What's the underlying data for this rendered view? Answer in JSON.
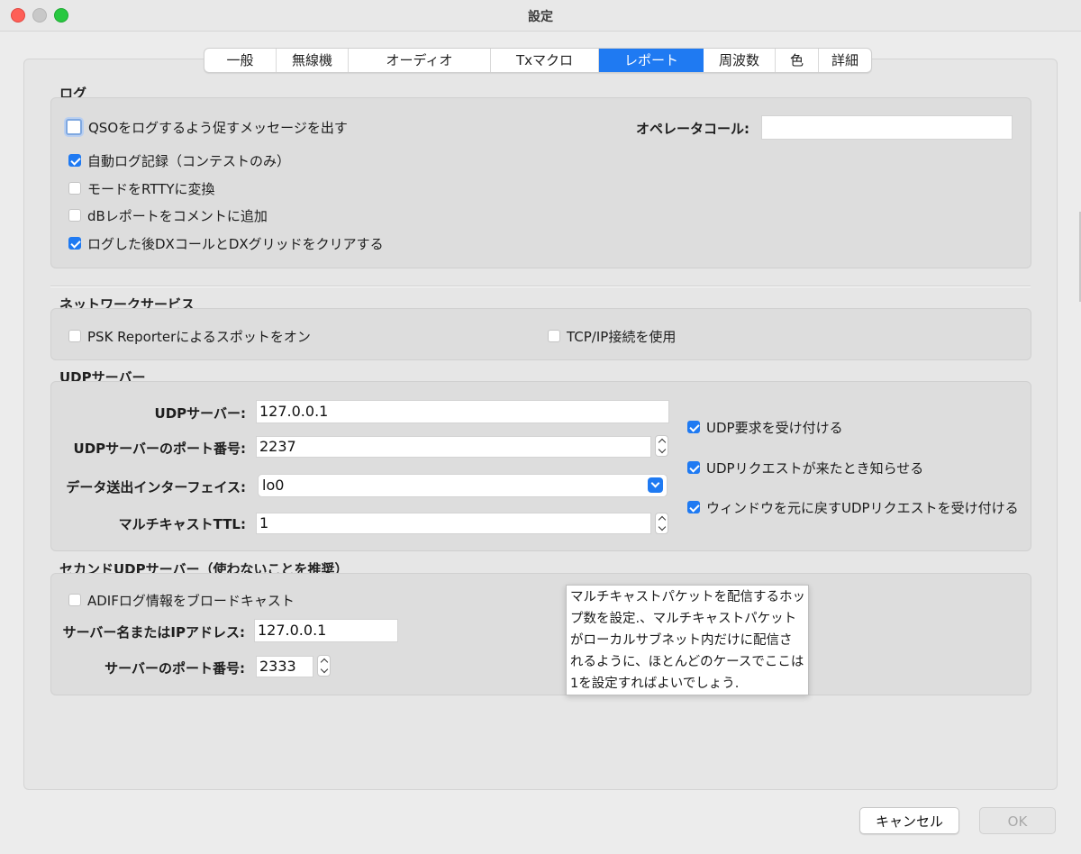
{
  "window": {
    "title": "設定"
  },
  "tabs": [
    {
      "label": "一般",
      "active": false
    },
    {
      "label": "無線機",
      "active": false
    },
    {
      "label": "オーディオ",
      "active": false
    },
    {
      "label": "Txマクロ",
      "active": false
    },
    {
      "label": "レポート",
      "active": true
    },
    {
      "label": "周波数",
      "active": false
    },
    {
      "label": "色",
      "active": false
    },
    {
      "label": "詳細",
      "active": false
    }
  ],
  "log": {
    "title": "ログ",
    "prompt_qso": {
      "label": "QSOをログするよう促すメッセージを出す",
      "checked": false
    },
    "auto_log": {
      "label": "自動ログ記録（コンテストのみ）",
      "checked": true
    },
    "convert_rtty": {
      "label": "モードをRTTYに変換",
      "checked": false
    },
    "db_report": {
      "label": "dBレポートをコメントに追加",
      "checked": false
    },
    "clear_dx": {
      "label": "ログした後DXコールとDXグリッドをクリアする",
      "checked": true
    },
    "operator_label": "オペレータコール:",
    "operator_value": ""
  },
  "network": {
    "title": "ネットワークサービス",
    "psk": {
      "label": "PSK Reporterによるスポットをオン",
      "checked": false
    },
    "tcp": {
      "label": "TCP/IP接続を使用",
      "checked": false
    }
  },
  "udp": {
    "title": "UDPサーバー",
    "server_label": "UDPサーバー:",
    "server_value": "127.0.0.1",
    "port_label": "UDPサーバーのポート番号:",
    "port_value": "2237",
    "iface_label": "データ送出インターフェイス:",
    "iface_value": "lo0",
    "ttl_label": "マルチキャストTTL:",
    "ttl_value": "1",
    "accept": {
      "label": "UDP要求を受け付ける",
      "checked": true
    },
    "notify": {
      "label": "UDPリクエストが来たとき知らせる",
      "checked": true
    },
    "restore": {
      "label": "ウィンドウを元に戻すUDPリクエストを受け付ける",
      "checked": true
    }
  },
  "second_udp": {
    "title": "セカンドUDPサーバー（使わないことを推奨）",
    "adif": {
      "label": "ADIFログ情報をブロードキャスト",
      "checked": false
    },
    "server_label": "サーバー名またはIPアドレス:",
    "server_value": "127.0.0.1",
    "port_label": "サーバーのポート番号:",
    "port_value": "2333"
  },
  "tooltip": {
    "lines": [
      "マルチキャストパケットを配信するホッ",
      "プ数を設定.、マルチキャストパケット",
      "がローカルサブネット内だけに配信さ",
      "れるように、ほとんどのケースでここは",
      "1を設定すればよいでしょう."
    ]
  },
  "buttons": {
    "cancel": "キャンセル",
    "ok": "OK"
  },
  "colors": {
    "accent": "#1f7af2",
    "close": "#fe5f57",
    "maximize": "#28c840"
  }
}
